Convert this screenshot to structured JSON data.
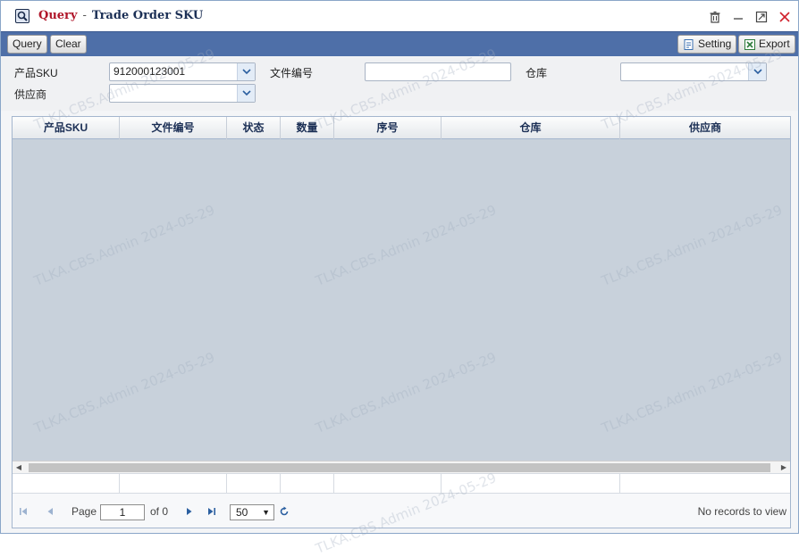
{
  "title": {
    "query": "Query",
    "separator": "-",
    "main": "Trade Order SKU"
  },
  "toolbar": {
    "query_label": "Query",
    "clear_label": "Clear",
    "setting_label": "Setting",
    "export_label": "Export"
  },
  "filters": {
    "sku_label": "产品SKU",
    "sku_value": "912000123001",
    "doc_no_label": "文件编号",
    "doc_no_value": "",
    "warehouse_label": "仓库",
    "warehouse_value": "",
    "supplier_label": "供应商",
    "supplier_value": ""
  },
  "grid": {
    "columns": [
      "产品SKU",
      "文件编号",
      "状态",
      "数量",
      "序号",
      "仓库",
      "供应商"
    ],
    "rows": []
  },
  "pager": {
    "page_label": "Page",
    "page_value": "1",
    "of_label": "of 0",
    "page_size": "50",
    "records_text": "No records to view"
  },
  "watermark": "TLKA.CBS.Admin 2024-05-29",
  "colors": {
    "toolbar": "#4e6fa8",
    "title_query": "#b0162a",
    "title_main": "#1b2f55",
    "grid_body": "#c8d1db"
  },
  "icons": {
    "title": "search-icon",
    "window_controls": [
      "trash-icon",
      "minimize-icon",
      "maximize-icon",
      "close-icon"
    ],
    "setting": "settings-icon",
    "export": "excel-icon",
    "pager": [
      "first-page-icon",
      "prev-page-icon",
      "next-page-icon",
      "last-page-icon",
      "refresh-icon"
    ]
  }
}
